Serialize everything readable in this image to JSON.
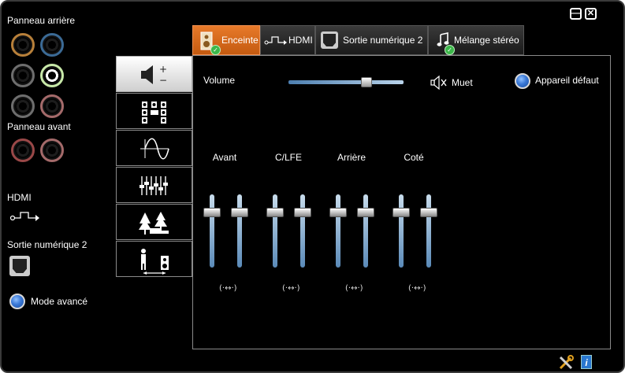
{
  "left": {
    "rear_panel_label": "Panneau arrière",
    "front_panel_label": "Panneau avant",
    "hdmi_label": "HDMI",
    "digital_out_label": "Sortie numérique 2",
    "advanced_mode_label": "Mode avancé"
  },
  "window": {
    "minimize_label": "—",
    "close_label": "✕"
  },
  "tabs": [
    {
      "label": "Enceinte",
      "active": true
    },
    {
      "label": "HDMI",
      "active": false
    },
    {
      "label": "Sortie numérique 2",
      "active": false
    },
    {
      "label": "Mélange stéréo",
      "active": false
    }
  ],
  "side_tabs": [
    {
      "icon": "speaker-volume-icon",
      "active": true
    },
    {
      "icon": "speaker-config-icon",
      "active": false
    },
    {
      "icon": "sine-wave-icon",
      "active": false
    },
    {
      "icon": "equalizer-icon",
      "active": false
    },
    {
      "icon": "environment-icon",
      "active": false
    },
    {
      "icon": "room-correction-icon",
      "active": false
    }
  ],
  "panel": {
    "volume_label": "Volume",
    "volume_level": 0.7,
    "mute_label": "Muet",
    "default_device_label": "Appareil défaut"
  },
  "channels": [
    {
      "label": "Avant",
      "link": "(·↔·)"
    },
    {
      "label": "C/LFE",
      "link": "(·↔·)"
    },
    {
      "label": "Arrière",
      "link": "(·↔·)"
    },
    {
      "label": "Coté",
      "link": "(·↔·)"
    }
  ],
  "colors": {
    "accent_orange": "#e87a2a",
    "slider_blue": "#4d7fb0",
    "background": "#000000"
  }
}
